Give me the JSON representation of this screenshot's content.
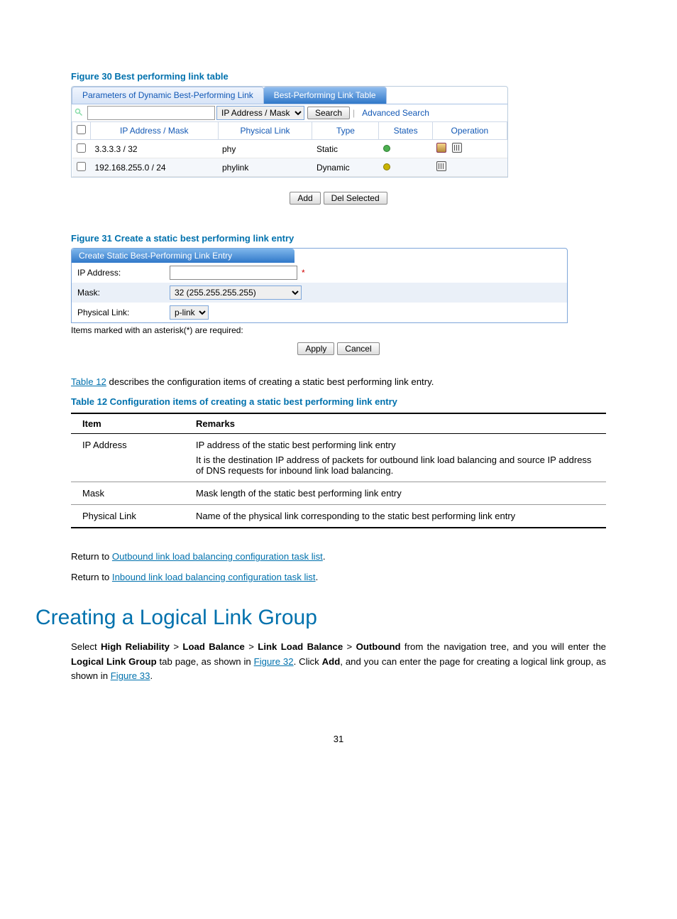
{
  "figures": {
    "fig30": {
      "caption": "Figure 30 Best performing link table",
      "tabs": {
        "inactive": "Parameters of Dynamic Best-Performing Link",
        "active": "Best-Performing Link Table"
      },
      "search": {
        "dropdown": "IP Address / Mask",
        "button": "Search",
        "advanced": "Advanced Search"
      },
      "columns": {
        "c1": "IP Address / Mask",
        "c2": "Physical Link",
        "c3": "Type",
        "c4": "States",
        "c5": "Operation"
      },
      "rows": {
        "r0": {
          "ip": "3.3.3.3 / 32",
          "phy": "phy",
          "type": "Static"
        },
        "r1": {
          "ip": "192.168.255.0 / 24",
          "phy": "phylink",
          "type": "Dynamic"
        }
      },
      "buttons": {
        "add": "Add",
        "del": "Del Selected"
      }
    },
    "fig31": {
      "caption": "Figure 31 Create a static best performing link entry",
      "header": "Create Static Best-Performing Link Entry",
      "labels": {
        "ip": "IP Address:",
        "mask": "Mask:",
        "phy": "Physical Link:"
      },
      "values": {
        "ip": "",
        "mask": "32 (255.255.255.255)",
        "phy": "p-link"
      },
      "required_note": "Items marked with an asterisk(*) are required:",
      "buttons": {
        "apply": "Apply",
        "cancel": "Cancel"
      }
    }
  },
  "intro_text": {
    "pre_link": "",
    "link": "Table 12",
    "post_link": " describes the configuration items of creating a static best performing link entry."
  },
  "table12": {
    "caption": "Table 12 Configuration items of creating a static best performing link entry",
    "headers": {
      "h1": "Item",
      "h2": "Remarks"
    },
    "rows": {
      "r0": {
        "item": "IP Address",
        "remarks_l1": "IP address of the static best performing link entry",
        "remarks_l2": "It is the destination IP address of packets for outbound link load balancing and source IP address of DNS requests for inbound link load balancing."
      },
      "r1": {
        "item": "Mask",
        "remarks": "Mask length of the static best performing link entry"
      },
      "r2": {
        "item": "Physical Link",
        "remarks": "Name of the physical link corresponding to the static best performing link entry"
      }
    }
  },
  "returns": {
    "prefix": "Return to ",
    "r0": "Outbound link load balancing configuration task list",
    "r1": "Inbound link load balancing configuration task list"
  },
  "section": {
    "title": "Creating a Logical Link Group",
    "p": {
      "t1": "Select ",
      "b1": "High Reliability",
      "gt": " > ",
      "b2": "Load Balance",
      "b3": "Link Load Balance",
      "b4": "Outbound",
      "t2": " from the navigation tree, and you will enter the ",
      "b5": "Logical Link Group",
      "t3": " tab page, as shown in ",
      "l1": "Figure 32",
      "t4": ". Click ",
      "b6": "Add",
      "t5": ", and you can enter the page for creating a logical link group, as shown in ",
      "l2": "Figure 33",
      "t6": "."
    }
  },
  "page_number": "31"
}
